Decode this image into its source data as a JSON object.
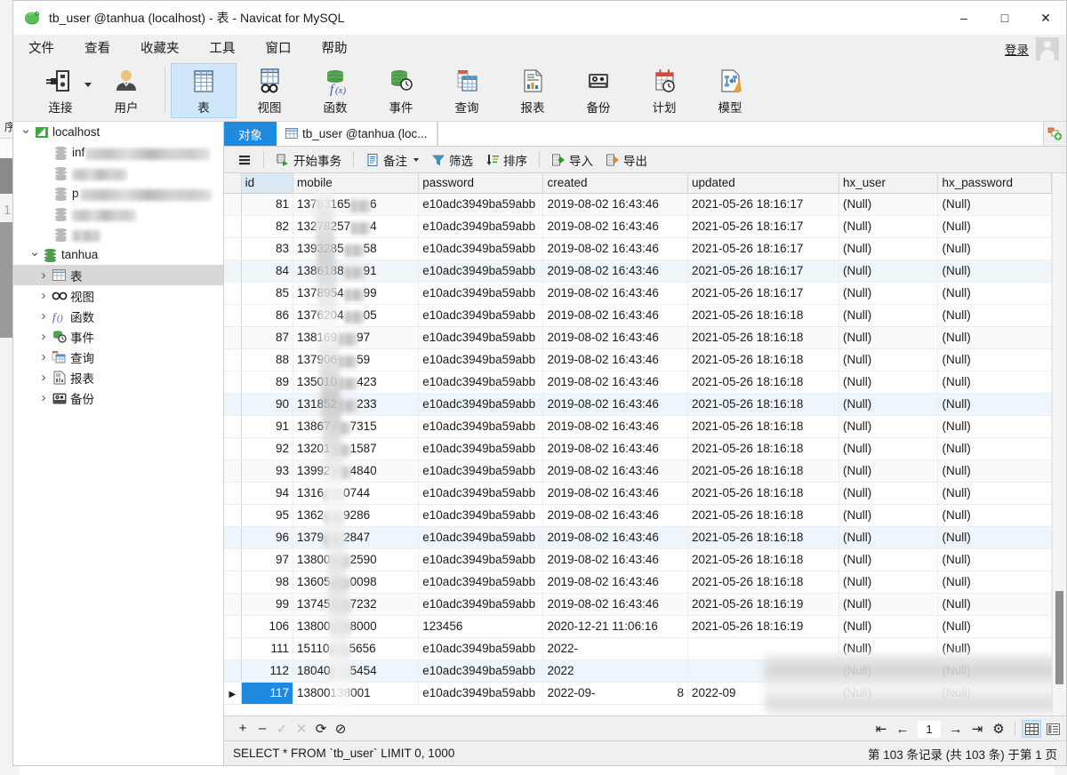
{
  "window": {
    "title": "tb_user @tanhua (localhost) - 表 - Navicat for MySQL",
    "logo": "navicat-logo-icon",
    "minimize": "–",
    "maximize": "□",
    "close": "✕"
  },
  "menu": {
    "items": [
      {
        "label": "文件",
        "name": "menu-file"
      },
      {
        "label": "查看",
        "name": "menu-view"
      },
      {
        "label": "收藏夹",
        "name": "menu-favorites"
      },
      {
        "label": "工具",
        "name": "menu-tools"
      },
      {
        "label": "窗口",
        "name": "menu-window"
      },
      {
        "label": "帮助",
        "name": "menu-help"
      }
    ],
    "login_label": "登录"
  },
  "ribbon": {
    "items": [
      {
        "label": "连接",
        "icon": "connection-icon",
        "active": false,
        "dropdown": true
      },
      {
        "label": "用户",
        "icon": "user-icon",
        "active": false,
        "dropdown": false
      },
      {
        "label": "表",
        "icon": "table-icon",
        "active": true,
        "dropdown": false
      },
      {
        "label": "视图",
        "icon": "view-icon",
        "active": false,
        "dropdown": false
      },
      {
        "label": "函数",
        "icon": "function-icon",
        "active": false,
        "dropdown": false
      },
      {
        "label": "事件",
        "icon": "event-icon",
        "active": false,
        "dropdown": false
      },
      {
        "label": "查询",
        "icon": "query-icon",
        "active": false,
        "dropdown": false
      },
      {
        "label": "报表",
        "icon": "report-icon",
        "active": false,
        "dropdown": false
      },
      {
        "label": "备份",
        "icon": "backup-icon",
        "active": false,
        "dropdown": false
      },
      {
        "label": "计划",
        "icon": "schedule-icon",
        "active": false,
        "dropdown": false
      },
      {
        "label": "模型",
        "icon": "model-icon",
        "active": false,
        "dropdown": false
      }
    ]
  },
  "sidebar": {
    "connection": {
      "label": "localhost",
      "icon": "navicat-connection-icon",
      "expanded": true
    },
    "databases": [
      {
        "label": "inf",
        "blurred": true,
        "blur_width": 140,
        "icon": "database-icon"
      },
      {
        "label": "",
        "blurred": true,
        "blur_width": 62,
        "icon": "database-icon"
      },
      {
        "label": "p",
        "blurred": true,
        "blur_width": 148,
        "icon": "database-icon"
      },
      {
        "label": "",
        "blurred": true,
        "blur_width": 72,
        "icon": "database-icon"
      },
      {
        "label": "",
        "blurred": true,
        "blur_width": 32,
        "icon": "database-icon"
      }
    ],
    "active_db": {
      "label": "tanhua",
      "icon": "database-icon",
      "expanded": true
    },
    "db_children": [
      {
        "label": "表",
        "icon": "table-icon",
        "selected": true
      },
      {
        "label": "视图",
        "icon": "view-icon",
        "selected": false
      },
      {
        "label": "函数",
        "icon": "function-icon",
        "selected": false
      },
      {
        "label": "事件",
        "icon": "event-icon",
        "selected": false
      },
      {
        "label": "查询",
        "icon": "query-icon",
        "selected": false
      },
      {
        "label": "报表",
        "icon": "report-icon",
        "selected": false
      },
      {
        "label": "备份",
        "icon": "backup-icon",
        "selected": false
      }
    ]
  },
  "tabs": {
    "object_tab": "对象",
    "data_tab": "tb_user @tanhua (loc...",
    "add_tab_icon": "add-tab-icon"
  },
  "data_toolbar": {
    "menu_icon": "hamburger-icon",
    "buttons": [
      {
        "label": "开始事务",
        "icon": "begin-transaction-icon",
        "caret": false
      },
      {
        "label": "备注",
        "icon": "note-icon",
        "caret": true
      },
      {
        "label": "筛选",
        "icon": "filter-icon",
        "caret": false
      },
      {
        "label": "排序",
        "icon": "sort-icon",
        "caret": false
      },
      {
        "label": "导入",
        "icon": "import-icon",
        "caret": false
      },
      {
        "label": "导出",
        "icon": "export-icon",
        "caret": false
      }
    ]
  },
  "grid": {
    "columns": [
      "id",
      "mobile",
      "password",
      "created",
      "updated",
      "hx_user",
      "hx_password"
    ],
    "null_label": "(Null)",
    "rows": [
      {
        "id": "81",
        "mobile_pre": "13783165",
        "mobile_post": "6",
        "password": "e10adc3949ba59abb",
        "created": "2019-08-02 16:43:46",
        "updated": "2021-05-26 18:16:17",
        "hx_user": "(Null)",
        "hx_password": "(Null)"
      },
      {
        "id": "82",
        "mobile_pre": "13278257",
        "mobile_post": "4",
        "password": "e10adc3949ba59abb",
        "created": "2019-08-02 16:43:46",
        "updated": "2021-05-26 18:16:17",
        "hx_user": "(Null)",
        "hx_password": "(Null)"
      },
      {
        "id": "83",
        "mobile_pre": "1393285",
        "mobile_post": "58",
        "password": "e10adc3949ba59abb",
        "created": "2019-08-02 16:43:46",
        "updated": "2021-05-26 18:16:17",
        "hx_user": "(Null)",
        "hx_password": "(Null)"
      },
      {
        "id": "84",
        "mobile_pre": "1386188",
        "mobile_post": "91",
        "password": "e10adc3949ba59abb",
        "created": "2019-08-02 16:43:46",
        "updated": "2021-05-26 18:16:17",
        "hx_user": "(Null)",
        "hx_password": "(Null)"
      },
      {
        "id": "85",
        "mobile_pre": "1378954",
        "mobile_post": "99",
        "password": "e10adc3949ba59abb",
        "created": "2019-08-02 16:43:46",
        "updated": "2021-05-26 18:16:17",
        "hx_user": "(Null)",
        "hx_password": "(Null)"
      },
      {
        "id": "86",
        "mobile_pre": "1376204",
        "mobile_post": "05",
        "password": "e10adc3949ba59abb",
        "created": "2019-08-02 16:43:46",
        "updated": "2021-05-26 18:16:18",
        "hx_user": "(Null)",
        "hx_password": "(Null)"
      },
      {
        "id": "87",
        "mobile_pre": "138169",
        "mobile_post": "97",
        "password": "e10adc3949ba59abb",
        "created": "2019-08-02 16:43:46",
        "updated": "2021-05-26 18:16:18",
        "hx_user": "(Null)",
        "hx_password": "(Null)"
      },
      {
        "id": "88",
        "mobile_pre": "137906",
        "mobile_post": "59",
        "password": "e10adc3949ba59abb",
        "created": "2019-08-02 16:43:46",
        "updated": "2021-05-26 18:16:18",
        "hx_user": "(Null)",
        "hx_password": "(Null)"
      },
      {
        "id": "89",
        "mobile_pre": "135010",
        "mobile_post": "423",
        "password": "e10adc3949ba59abb",
        "created": "2019-08-02 16:43:46",
        "updated": "2021-05-26 18:16:18",
        "hx_user": "(Null)",
        "hx_password": "(Null)"
      },
      {
        "id": "90",
        "mobile_pre": "131852",
        "mobile_post": "233",
        "password": "e10adc3949ba59abb",
        "created": "2019-08-02 16:43:46",
        "updated": "2021-05-26 18:16:18",
        "hx_user": "(Null)",
        "hx_password": "(Null)"
      },
      {
        "id": "91",
        "mobile_pre": "13867",
        "mobile_post": "7315",
        "password": "e10adc3949ba59abb",
        "created": "2019-08-02 16:43:46",
        "updated": "2021-05-26 18:16:18",
        "hx_user": "(Null)",
        "hx_password": "(Null)"
      },
      {
        "id": "92",
        "mobile_pre": "13201",
        "mobile_post": "1587",
        "password": "e10adc3949ba59abb",
        "created": "2019-08-02 16:43:46",
        "updated": "2021-05-26 18:16:18",
        "hx_user": "(Null)",
        "hx_password": "(Null)"
      },
      {
        "id": "93",
        "mobile_pre": "13992",
        "mobile_post": "4840",
        "password": "e10adc3949ba59abb",
        "created": "2019-08-02 16:43:46",
        "updated": "2021-05-26 18:16:18",
        "hx_user": "(Null)",
        "hx_password": "(Null)"
      },
      {
        "id": "94",
        "mobile_pre": "1316",
        "mobile_post": "0744",
        "password": "e10adc3949ba59abb",
        "created": "2019-08-02 16:43:46",
        "updated": "2021-05-26 18:16:18",
        "hx_user": "(Null)",
        "hx_password": "(Null)"
      },
      {
        "id": "95",
        "mobile_pre": "1362",
        "mobile_post": "9286",
        "password": "e10adc3949ba59abb",
        "created": "2019-08-02 16:43:46",
        "updated": "2021-05-26 18:16:18",
        "hx_user": "(Null)",
        "hx_password": "(Null)"
      },
      {
        "id": "96",
        "mobile_pre": "1379",
        "mobile_post": "2847",
        "password": "e10adc3949ba59abb",
        "created": "2019-08-02 16:43:46",
        "updated": "2021-05-26 18:16:18",
        "hx_user": "(Null)",
        "hx_password": "(Null)"
      },
      {
        "id": "97",
        "mobile_pre": "13800",
        "mobile_post": "2590",
        "password": "e10adc3949ba59abb",
        "created": "2019-08-02 16:43:46",
        "updated": "2021-05-26 18:16:18",
        "hx_user": "(Null)",
        "hx_password": "(Null)"
      },
      {
        "id": "98",
        "mobile_pre": "13605",
        "mobile_post": "0098",
        "password": "e10adc3949ba59abb",
        "created": "2019-08-02 16:43:46",
        "updated": "2021-05-26 18:16:18",
        "hx_user": "(Null)",
        "hx_password": "(Null)"
      },
      {
        "id": "99",
        "mobile_pre": "13745",
        "mobile_post": "7232",
        "password": "e10adc3949ba59abb",
        "created": "2019-08-02 16:43:46",
        "updated": "2021-05-26 18:16:19",
        "hx_user": "(Null)",
        "hx_password": "(Null)"
      },
      {
        "id": "106",
        "mobile_pre": "13800",
        "mobile_post": "8000",
        "password": "123456",
        "created": "2020-12-21 11:06:16",
        "updated": "2021-05-26 18:16:19",
        "hx_user": "(Null)",
        "hx_password": "(Null)"
      },
      {
        "id": "111",
        "mobile_pre": "15110",
        "mobile_post": "5656",
        "password": "e10adc3949ba59abb",
        "created": "2022-",
        "updated": "",
        "hx_user": "(Null)",
        "hx_password": "(Null)"
      },
      {
        "id": "112",
        "mobile_pre": "18040",
        "mobile_post": "5454",
        "password": "e10adc3949ba59abb",
        "created": "2022",
        "updated": "",
        "hx_user": "(Null)",
        "hx_password": "(Null)"
      },
      {
        "id": "117",
        "mobile_pre": "138001",
        "mobile_post": "38001",
        "password": "e10adc3949ba59abb",
        "created": "2022-09-",
        "updated": "2022-09",
        "hx_user": "(Null)",
        "hx_password": "(Null)"
      }
    ]
  },
  "record_bar": {
    "add": "+",
    "remove": "–",
    "apply": "✓",
    "cancel": "✕",
    "refresh": "⟳",
    "stop": "⊘",
    "first": "⇤",
    "prev": "←",
    "page_value": "1",
    "next": "→",
    "last": "⇥",
    "settings": "⚙",
    "grid_view_icon": "grid-view-icon",
    "form_view_icon": "form-view-icon"
  },
  "status": {
    "sql": "SELECT * FROM `tb_user` LIMIT 0, 1000",
    "record_count": "第 103 条记录 (共 103 条) 于第 1 页"
  }
}
